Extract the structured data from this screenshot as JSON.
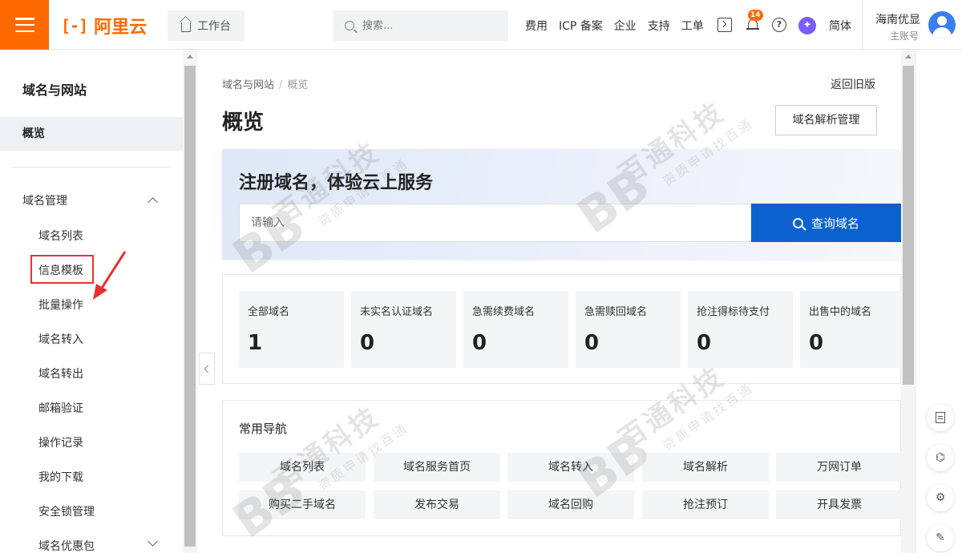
{
  "topbar": {
    "logo_mark": "[-]",
    "logo_text": "阿里云",
    "workbench": "工作台",
    "search_placeholder": "搜索...",
    "nav": [
      "费用",
      "ICP 备案",
      "企业",
      "支持",
      "工单"
    ],
    "notification_count": "14",
    "help_glyph": "?",
    "lang": "简体",
    "user_name": "海南优显",
    "user_role": "主账号"
  },
  "sidebar": {
    "title": "域名与网站",
    "overview": "概览",
    "group": "域名管理",
    "items": [
      "域名列表",
      "信息模板",
      "批量操作",
      "域名转入",
      "域名转出",
      "邮箱验证",
      "操作记录",
      "我的下载",
      "安全锁管理",
      "域名优惠包"
    ],
    "highlighted_item": "信息模板"
  },
  "main": {
    "breadcrumb": [
      "域名与网站",
      "概览"
    ],
    "breadcrumb_sep": "/",
    "back_old": "返回旧版",
    "title": "概览",
    "dns_button": "域名解析管理",
    "register": {
      "title": "注册域名，体验云上服务",
      "placeholder": "请输入",
      "button": "查询域名"
    },
    "stats": [
      {
        "label": "全部域名",
        "value": "1"
      },
      {
        "label": "未实名认证域名",
        "value": "0"
      },
      {
        "label": "急需续费域名",
        "value": "0"
      },
      {
        "label": "急需赎回域名",
        "value": "0"
      },
      {
        "label": "抢注得标待支付",
        "value": "0"
      },
      {
        "label": "出售中的域名",
        "value": "0"
      }
    ],
    "nav_title": "常用导航",
    "nav_items": [
      "域名列表",
      "域名服务首页",
      "域名转入",
      "域名解析",
      "万网订单",
      "购买二手域名",
      "发布交易",
      "域名回购",
      "抢注预订",
      "开具发票"
    ]
  },
  "watermark": {
    "main": "百通科技",
    "sub": "资质申请找百通",
    "logo": "BB"
  },
  "colors": {
    "brand": "#ff6a00",
    "primary_button": "#0b62cf",
    "highlight": "#e8312f"
  }
}
